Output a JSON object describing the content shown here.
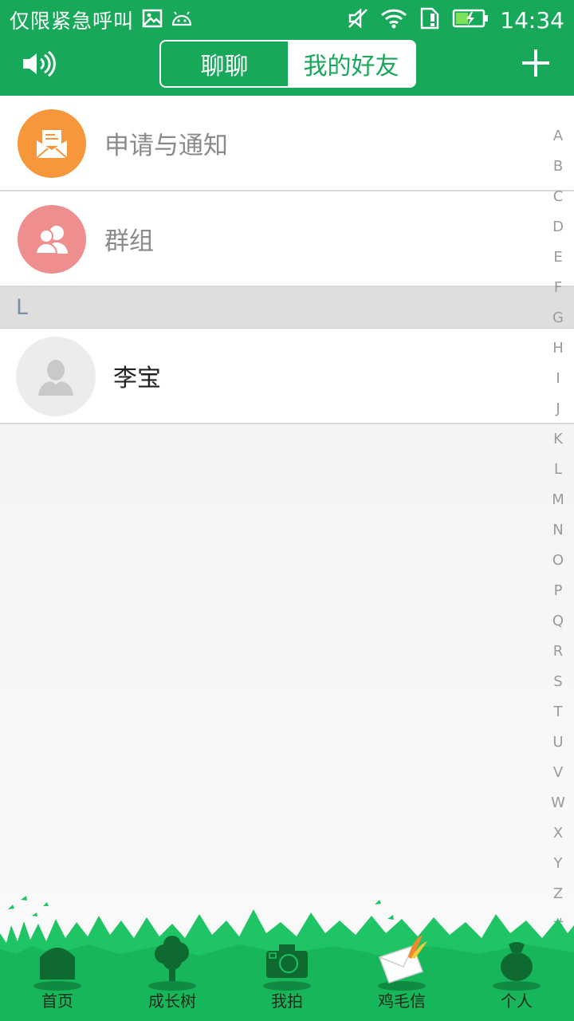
{
  "status_bar": {
    "carrier_text": "仅限紧急呼叫",
    "time": "14:34",
    "icons": [
      "image-icon",
      "android-icon",
      "mute-icon",
      "wifi-icon",
      "sim-alert-icon",
      "battery-charging-icon"
    ]
  },
  "header": {
    "tabs": [
      {
        "label": "聊聊",
        "active": false
      },
      {
        "label": "我的好友",
        "active": true
      }
    ],
    "left_icon": "speaker-icon",
    "right_icon": "plus-icon"
  },
  "list": {
    "fixed_items": [
      {
        "label": "申请与通知",
        "icon": "mail-document-icon",
        "color": "#f7963a"
      },
      {
        "label": "群组",
        "icon": "group-icon",
        "color": "#ef8e8e"
      }
    ],
    "sections": [
      {
        "letter": "L",
        "friends": [
          {
            "name": "李宝",
            "icon": "default-avatar-icon"
          }
        ]
      }
    ]
  },
  "alphabet_index": [
    "A",
    "B",
    "C",
    "D",
    "E",
    "F",
    "G",
    "H",
    "I",
    "J",
    "K",
    "L",
    "M",
    "N",
    "O",
    "P",
    "Q",
    "R",
    "S",
    "T",
    "U",
    "V",
    "W",
    "X",
    "Y",
    "Z",
    "#"
  ],
  "bottom_nav": [
    {
      "label": "首页",
      "icon": "house-icon"
    },
    {
      "label": "成长树",
      "icon": "tree-icon"
    },
    {
      "label": "我拍",
      "icon": "camera-icon"
    },
    {
      "label": "鸡毛信",
      "icon": "letter-feather-icon"
    },
    {
      "label": "个人",
      "icon": "person-bag-icon"
    }
  ],
  "colors": {
    "brand_green": "#17a85a",
    "nav_green": "#1fc465",
    "icon_dark_green": "#0f6a32"
  }
}
